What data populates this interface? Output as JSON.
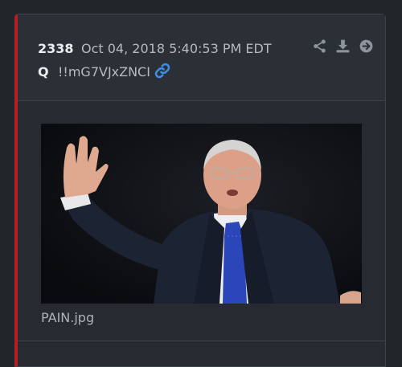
{
  "post": {
    "number": "2338",
    "timestamp": "Oct 04, 2018 5:40:53 PM EDT",
    "author": "Q",
    "tripcode": "!!mG7VJxZNCI",
    "actions": [
      "share-icon",
      "download-icon",
      "arrow-right-circle-icon"
    ],
    "attachment": {
      "filename": "PAIN.jpg"
    }
  },
  "colors": {
    "accent": "#b51e24",
    "link": "#3d8ee6",
    "background": "#22262b",
    "card": "#2b3037"
  }
}
